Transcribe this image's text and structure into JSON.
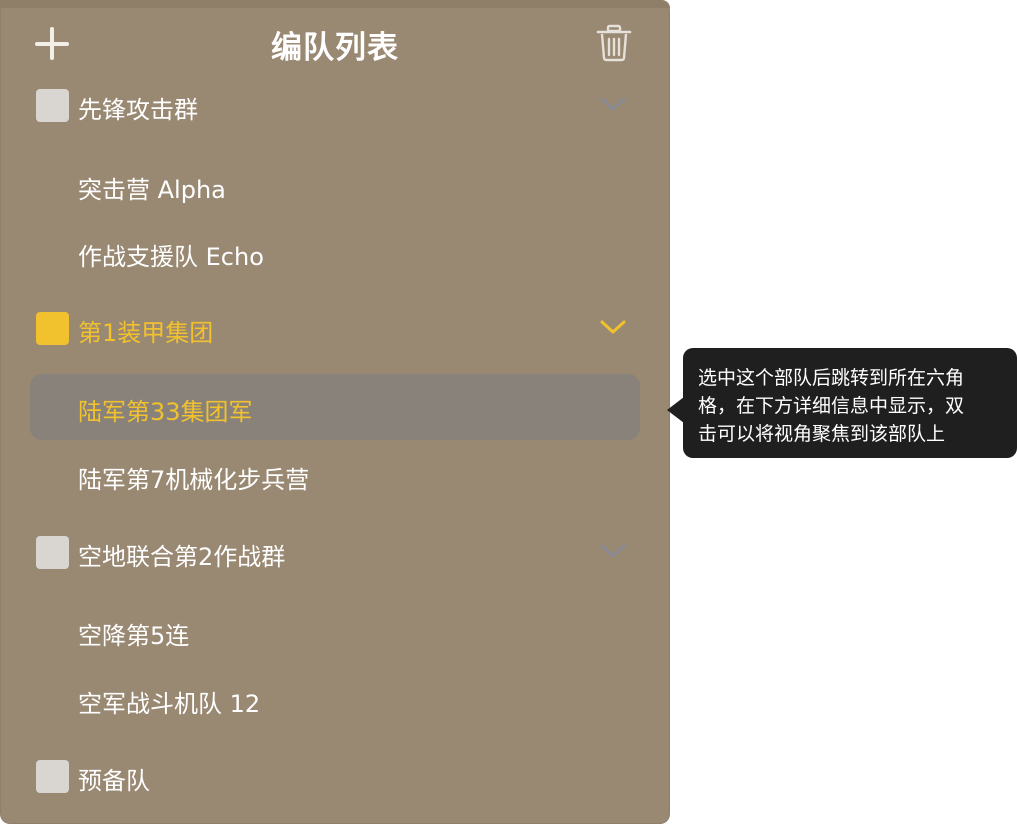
{
  "panel": {
    "title": "编队列表",
    "add_icon": "plus-icon",
    "delete_icon": "trash-icon"
  },
  "groups": [
    {
      "label": "先锋攻击群",
      "checked": false,
      "active": false,
      "expand_icon": "chevron-down-icon",
      "items": [
        {
          "label": "突击营 Alpha",
          "selected": false
        },
        {
          "label": "作战支援队 Echo",
          "selected": false
        }
      ]
    },
    {
      "label": "第1装甲集团",
      "checked": true,
      "active": true,
      "expand_icon": "chevron-down-icon",
      "items": [
        {
          "label": "陆军第33集团军",
          "selected": true
        },
        {
          "label": "陆军第7机械化步兵营",
          "selected": false
        }
      ]
    },
    {
      "label": "空地联合第2作战群",
      "checked": false,
      "active": false,
      "expand_icon": "chevron-down-icon",
      "items": [
        {
          "label": "空降第5连",
          "selected": false
        },
        {
          "label": "空军战斗机队 12",
          "selected": false
        }
      ]
    },
    {
      "label": "预备队",
      "checked": false,
      "active": false,
      "items": []
    }
  ],
  "tooltip": {
    "line1": "选中这个部队后跳转到所在六角",
    "line2": "格，在下方详细信息中显示，双",
    "line3": "击可以将视角聚焦到该部队上"
  },
  "colors": {
    "panel_bg": "#998872",
    "accent": "#f2c12e",
    "selected_row_bg": "#88827b",
    "checkbox_default": "#d9d6d1",
    "tooltip_bg": "#1f1f1f",
    "chevron_default": "#8a8b95"
  }
}
